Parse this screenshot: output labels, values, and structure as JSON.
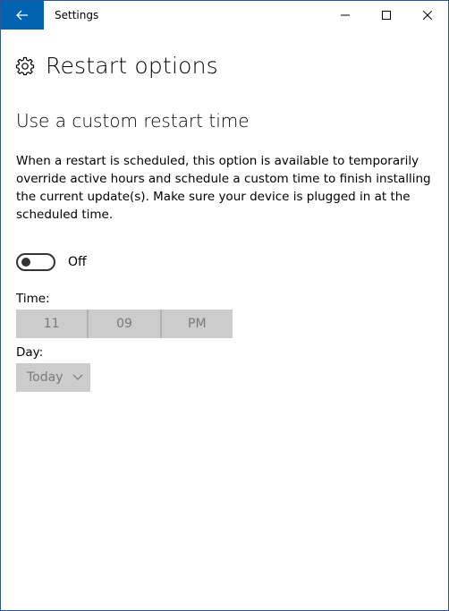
{
  "window": {
    "title": "Settings",
    "accent_color": "#0063b1"
  },
  "icons": {
    "back": "back-arrow-icon",
    "minimize": "minimize-icon",
    "maximize": "maximize-icon",
    "close": "close-icon",
    "settings": "gear-icon",
    "dropdown": "chevron-down-icon"
  },
  "page": {
    "title": "Restart options",
    "section_title": "Use a custom restart time",
    "description": "When a restart is scheduled, this option is available to temporarily override active hours and schedule a custom time to finish installing the current update(s). Make sure your device is plugged in at the scheduled time."
  },
  "toggle": {
    "state_label": "Off",
    "is_on": false
  },
  "time": {
    "label": "Time:",
    "hour": "11",
    "minute": "09",
    "period": "PM"
  },
  "day": {
    "label": "Day:",
    "value": "Today"
  }
}
